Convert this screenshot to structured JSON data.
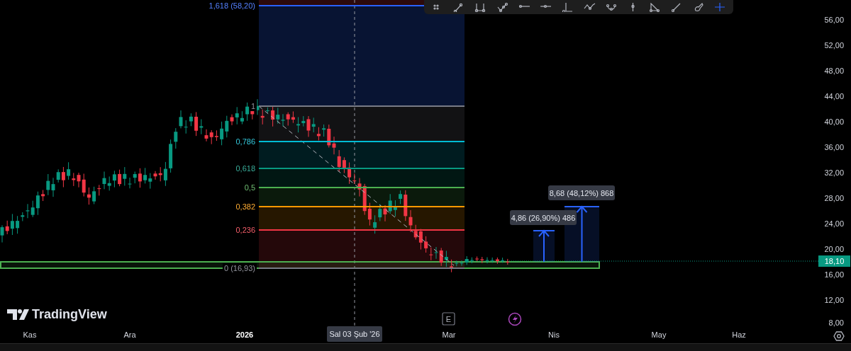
{
  "fib_retracement": {
    "levels": [
      {
        "label": "1,618 (58,20)",
        "color": "#2962ff"
      },
      {
        "label": "1",
        "color": "#787b86"
      },
      {
        "label": "0,786",
        "color": "#00bcd4"
      },
      {
        "label": "0,618",
        "color": "#089981"
      },
      {
        "label": "0,5",
        "color": "#4caf50"
      },
      {
        "label": "0,382",
        "color": "#ff9800"
      },
      {
        "label": "0,236",
        "color": "#f23645"
      },
      {
        "label": "0 (16,93)",
        "color": "#787b86"
      }
    ]
  },
  "measurements": [
    {
      "label": "4,86 (26,90%) 486"
    },
    {
      "label": "8,68 (48,12%) 868"
    }
  ],
  "brand": {
    "name": "TradingView"
  },
  "events_marker": {
    "label": "E"
  },
  "price_axis": {
    "ticks": [
      "56,00",
      "52,00",
      "48,00",
      "44,00",
      "40,00",
      "36,00",
      "32,00",
      "28,00",
      "24,00",
      "20,00",
      "16,00",
      "12,00",
      "8,00"
    ],
    "last_price": "18,10"
  },
  "time_axis": {
    "labels": [
      {
        "text": "Kas",
        "kind": "month"
      },
      {
        "text": "Ara",
        "kind": "month"
      },
      {
        "text": "2026",
        "kind": "year"
      },
      {
        "text": "Mar",
        "kind": "month"
      },
      {
        "text": "Nis",
        "kind": "month"
      },
      {
        "text": "May",
        "kind": "month"
      },
      {
        "text": "Haz",
        "kind": "month"
      }
    ],
    "crosshair_label": "Sal 03 Şub '26"
  }
}
